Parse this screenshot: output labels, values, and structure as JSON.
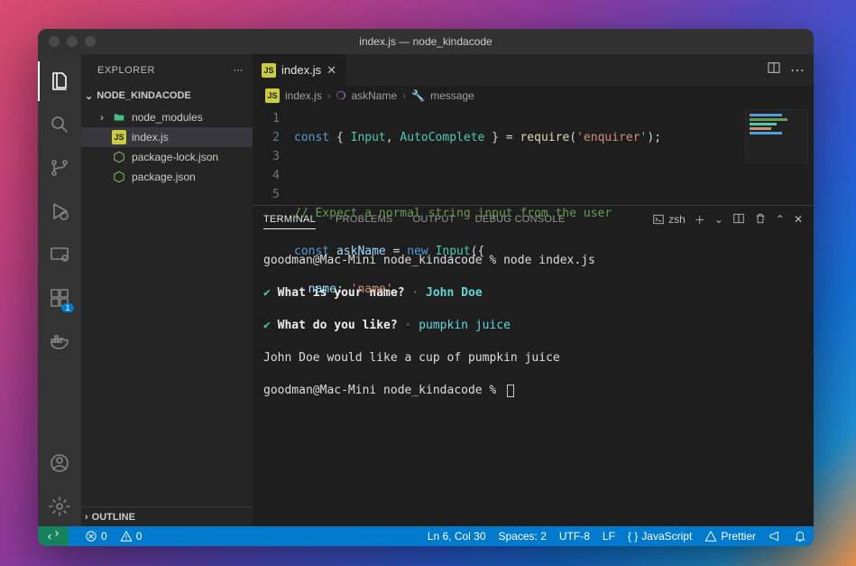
{
  "title": "index.js — node_kindacode",
  "sidebar": {
    "header": "EXPLORER",
    "folder": "NODE_KINDACODE",
    "items": [
      {
        "label": "node_modules",
        "type": "folder"
      },
      {
        "label": "index.js",
        "type": "js",
        "selected": true
      },
      {
        "label": "package-lock.json",
        "type": "npm"
      },
      {
        "label": "package.json",
        "type": "npm"
      }
    ],
    "outline": "OUTLINE"
  },
  "tab": {
    "label": "index.js"
  },
  "breadcrumbs": {
    "file": "index.js",
    "symbol1": "askName",
    "symbol2": "message"
  },
  "code": {
    "lines": [
      "1",
      "2",
      "3",
      "4",
      "5"
    ],
    "l1": {
      "kw": "const",
      "b1": "{ ",
      "fn1": "Input",
      "c": ", ",
      "fn2": "AutoComplete",
      "b2": " } = ",
      "call": "require",
      "p1": "(",
      "str": "'enquirer'",
      "p2": ");"
    },
    "l3": {
      "comment": "// Expect a normal string input from the user"
    },
    "l4": {
      "kw": "const",
      "sp": " ",
      "var": "askName",
      "eq": " = ",
      "newkw": "new",
      "sp2": " ",
      "fn": "Input",
      "tail": "({"
    },
    "l5": {
      "indent": "  ",
      "prop": "name",
      "colon": ": ",
      "str": "'name'",
      "comma": ","
    }
  },
  "panel": {
    "tabs": {
      "terminal": "TERMINAL",
      "problems": "PROBLEMS",
      "output": "OUTPUT",
      "debug": "DEBUG CONSOLE"
    },
    "shell": "zsh"
  },
  "terminal": {
    "l1": {
      "prompt": "goodman@Mac-Mini node_kindacode % ",
      "cmd": "node index.js"
    },
    "l2": {
      "check": "✔ ",
      "q": "What is your name?",
      "dot": " · ",
      "ans": "John Doe"
    },
    "l3": {
      "check": "✔ ",
      "q": "What do you like?",
      "dot": " · ",
      "ans": "pumpkin juice"
    },
    "l4": "John Doe would like a cup of pumpkin juice",
    "l5": "goodman@Mac-Mini node_kindacode % "
  },
  "status": {
    "errors": "0",
    "warnings": "0",
    "cursor": "Ln 6, Col 30",
    "spaces": "Spaces: 2",
    "encoding": "UTF-8",
    "eol": "LF",
    "lang": "JavaScript",
    "prettier": "Prettier"
  },
  "activity": {
    "ext_badge": "1"
  }
}
